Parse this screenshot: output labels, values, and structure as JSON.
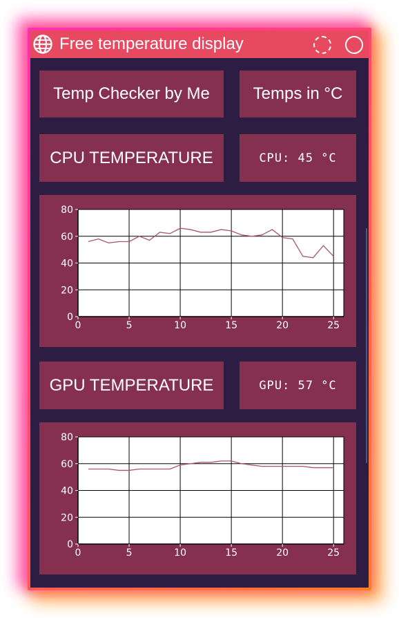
{
  "window": {
    "title": "Free temperature display",
    "icon": "globe-icon",
    "controls": [
      "minimize-circle-icon",
      "close-circle-icon"
    ]
  },
  "header": {
    "app_label": "Temp Checker by Me",
    "units_label": "Temps in °C"
  },
  "cpu": {
    "title": "CPU TEMPERATURE",
    "readout": "CPU: 45 °C"
  },
  "gpu": {
    "title": "GPU TEMPERATURE",
    "readout": "GPU: 57 °C"
  },
  "colors": {
    "titlebar": "#e64960",
    "background": "#2e1d43",
    "panel": "#86304f",
    "line": "#a8546e"
  },
  "chart_data": [
    {
      "type": "line",
      "x": [
        1,
        2,
        3,
        4,
        5,
        6,
        7,
        8,
        9,
        10,
        11,
        12,
        13,
        14,
        15,
        16,
        17,
        18,
        19,
        20,
        21,
        22,
        23,
        24,
        25
      ],
      "series": [
        {
          "values": [
            56,
            58,
            55,
            56,
            56,
            60,
            57,
            63,
            62,
            66,
            65,
            63,
            63,
            65,
            64,
            61,
            60,
            61,
            65,
            59,
            58,
            45,
            44,
            53,
            45
          ]
        }
      ],
      "xlim": [
        0,
        26
      ],
      "ylim": [
        0,
        80
      ],
      "xticks": [
        0,
        5,
        10,
        15,
        20,
        25
      ],
      "yticks": [
        0,
        20,
        40,
        60,
        80
      ],
      "grid": true
    },
    {
      "type": "line",
      "x": [
        1,
        2,
        3,
        4,
        5,
        6,
        7,
        8,
        9,
        10,
        11,
        12,
        13,
        14,
        15,
        16,
        17,
        18,
        19,
        20,
        21,
        22,
        23,
        24,
        25
      ],
      "series": [
        {
          "values": [
            56,
            56,
            56,
            55,
            55,
            56,
            56,
            56,
            56,
            59,
            60,
            61,
            61,
            62,
            62,
            60,
            59,
            58,
            58,
            58,
            58,
            58,
            57,
            57,
            57
          ]
        }
      ],
      "xlim": [
        0,
        26
      ],
      "ylim": [
        0,
        80
      ],
      "xticks": [
        0,
        5,
        10,
        15,
        20,
        25
      ],
      "yticks": [
        0,
        20,
        40,
        60,
        80
      ],
      "grid": true
    }
  ]
}
